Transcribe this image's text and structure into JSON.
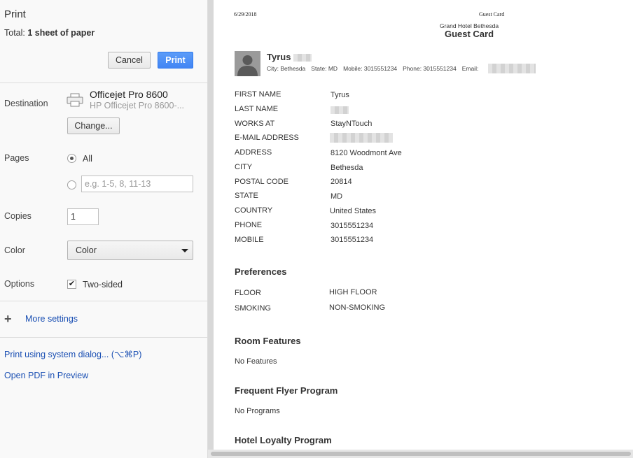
{
  "dialog": {
    "title": "Print",
    "total_prefix": "Total: ",
    "total_value": "1 sheet of paper",
    "cancel_label": "Cancel",
    "print_label": "Print",
    "destination": {
      "label": "Destination",
      "printer_name": "Officejet Pro 8600",
      "printer_sub": "HP Officejet Pro 8600-...",
      "change_label": "Change..."
    },
    "pages": {
      "label": "Pages",
      "all_label": "All",
      "custom_placeholder": "e.g. 1-5, 8, 11-13"
    },
    "copies": {
      "label": "Copies",
      "value": "1"
    },
    "color": {
      "label": "Color",
      "selected": "Color"
    },
    "options": {
      "label": "Options",
      "two_sided_label": "Two-sided",
      "two_sided_checked": true
    },
    "more_settings": "More settings",
    "system_dialog": "Print using system dialog... (⌥⌘P)",
    "open_pdf": "Open PDF in Preview"
  },
  "preview": {
    "date": "6/29/2018",
    "header_title": "Guest Card",
    "hotel_name": "Grand Hotel Bethesda",
    "card_title": "Guest Card",
    "guest": {
      "first_name": "Tyrus",
      "city_meta": "City: Bethesda",
      "state_meta": "State: MD",
      "mobile_meta": "Mobile: 3015551234",
      "phone_meta": "Phone: 3015551234",
      "email_meta": "Email:"
    },
    "fields": [
      {
        "label": "FIRST NAME",
        "value": "Tyrus"
      },
      {
        "label": "LAST NAME",
        "value": ""
      },
      {
        "label": "WORKS AT",
        "value": "StayNTouch"
      },
      {
        "label": "E-MAIL ADDRESS",
        "value": ""
      },
      {
        "label": "ADDRESS",
        "value": "8120 Woodmont Ave"
      },
      {
        "label": "CITY",
        "value": "Bethesda"
      },
      {
        "label": "POSTAL CODE",
        "value": "20814"
      },
      {
        "label": "STATE",
        "value": "MD"
      },
      {
        "label": "COUNTRY",
        "value": "United States"
      },
      {
        "label": "PHONE",
        "value": "3015551234"
      },
      {
        "label": "MOBILE",
        "value": "3015551234"
      }
    ],
    "preferences": {
      "title": "Preferences",
      "items": [
        {
          "label": "FLOOR",
          "value": "HIGH FLOOR"
        },
        {
          "label": "SMOKING",
          "value": "NON-SMOKING"
        }
      ]
    },
    "room_features": {
      "title": "Room Features",
      "text": "No Features"
    },
    "frequent_flyer": {
      "title": "Frequent Flyer Program",
      "text": "No Programs"
    },
    "hotel_loyalty": {
      "title": "Hotel Loyalty Program"
    }
  }
}
